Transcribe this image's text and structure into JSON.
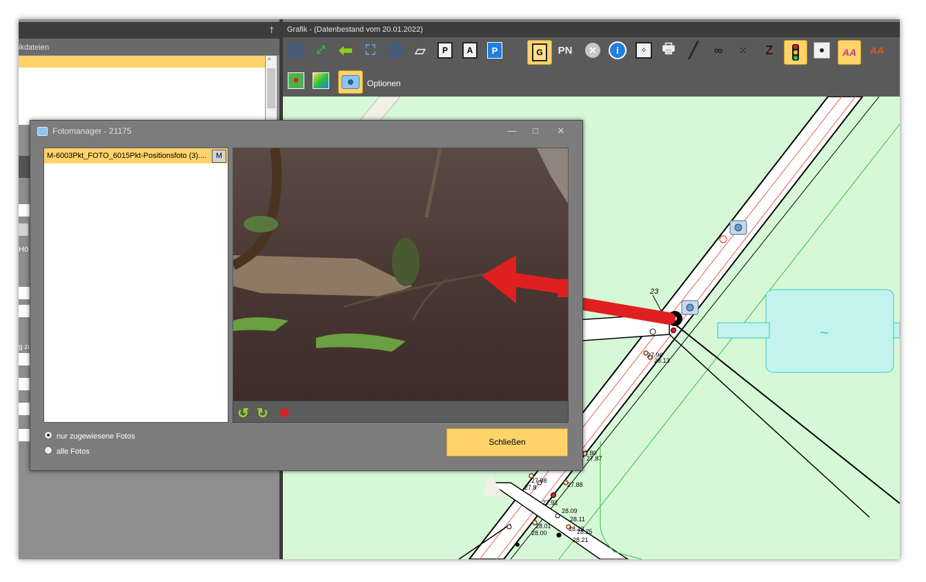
{
  "left_panel": {
    "pin": "†",
    "subtitle": "ikdateien",
    "stub_labels": [
      "Hö",
      "g zu"
    ]
  },
  "graphics": {
    "title": "Grafik - (Datenbestand vom 20.01.2022)",
    "toolbar_row1": [
      {
        "icon": "zoom-a-icon",
        "label": "A"
      },
      {
        "icon": "fit-extent-icon",
        "label": ""
      },
      {
        "icon": "back-arrow-icon",
        "label": ""
      },
      {
        "icon": "zoom-extent-icon",
        "label": ""
      },
      {
        "icon": "zoom-r-icon",
        "label": "R"
      },
      {
        "icon": "scroll-settings-icon",
        "label": ""
      },
      {
        "icon": "p-frame-icon",
        "label": "P"
      },
      {
        "icon": "a-frame-icon",
        "label": "A"
      },
      {
        "icon": "parking-icon",
        "label": "P"
      },
      {
        "icon": "g-frame-icon",
        "label": "G"
      },
      {
        "icon": "pn-icon",
        "label": "PN"
      },
      {
        "icon": "cancel-icon",
        "label": ""
      },
      {
        "icon": "info-icon",
        "label": "i"
      },
      {
        "icon": "dots-frame-icon",
        "label": ""
      },
      {
        "icon": "printer-icon",
        "label": ""
      },
      {
        "icon": "line-tool-icon",
        "label": ""
      },
      {
        "icon": "binoculars-icon",
        "label": ""
      },
      {
        "icon": "grid-dots-icon",
        "label": ""
      },
      {
        "icon": "z-strike-icon",
        "label": "Z"
      },
      {
        "icon": "traffic-light-icon",
        "label": ""
      },
      {
        "icon": "point-icon",
        "label": ""
      },
      {
        "icon": "text-style-icon",
        "label": "AA"
      },
      {
        "icon": "text-add-icon",
        "label": "AA"
      }
    ],
    "options_label": "Optionen",
    "map_labels": {
      "l1": "23",
      "l2": "~",
      "pts": [
        "27.96",
        "28.13",
        "27.80",
        "27.87",
        "27.98",
        "27.88",
        "27.91",
        "28.09",
        "28.11",
        "28.01",
        "28.13",
        "28.25",
        "28.00",
        "28.21",
        "27.8"
      ]
    }
  },
  "dialog": {
    "title": "Fotomanager -   21175",
    "minimize": "—",
    "maximize": "□",
    "close": "✕",
    "list_item": "M-6003Pkt_FOTO_6015Pkt-Positionsfoto  (3)....",
    "m_button": "M",
    "radio_assigned": "nur zugewiesene Fotos",
    "radio_all": "alle Fotos",
    "close_button": "Schließen",
    "photo_icons": {
      "rotate_left": "↺",
      "rotate_right": "↻",
      "delete": "✖"
    }
  },
  "colors": {
    "accent": "#ffd36a",
    "map_bg": "#d7f8d7",
    "arrow": "#e02020"
  }
}
